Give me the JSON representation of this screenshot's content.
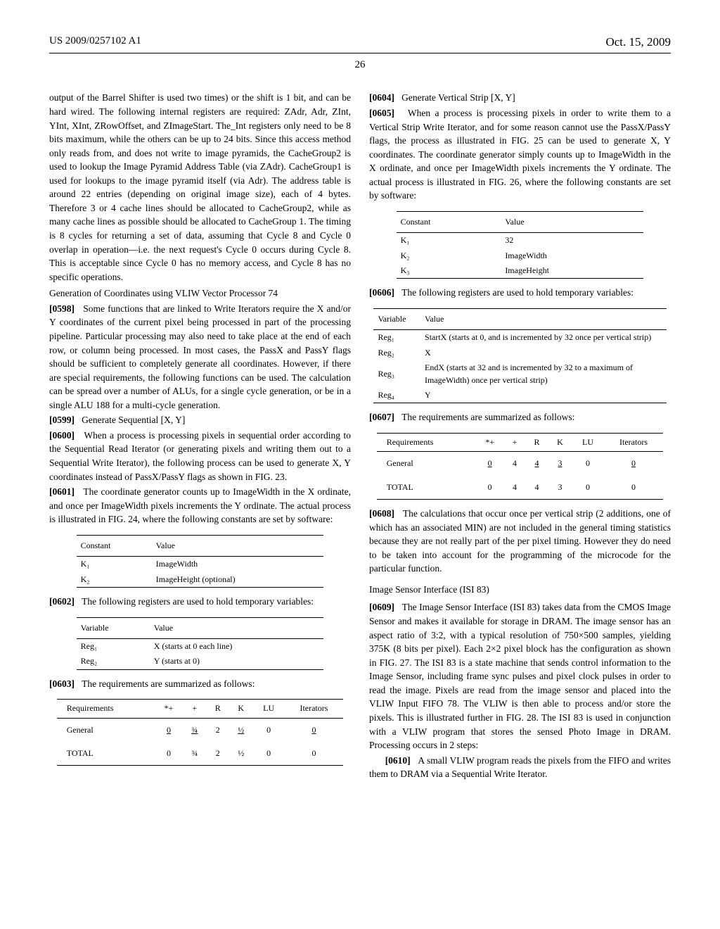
{
  "header": {
    "pub_number": "US 2009/0257102 A1",
    "date": "Oct. 15, 2009",
    "page": "26"
  },
  "left": {
    "p1": "output of the Barrel Shifter is used two times) or the shift is 1 bit, and can be hard wired. The following internal registers are required: ZAdr, Adr, ZInt, YInt, XInt, ZRowOffset, and ZImageStart. The_Int registers only need to be 8 bits maximum, while the others can be up to 24 bits. Since this access method only reads from, and does not write to image pyramids, the CacheGroup2 is used to lookup the Image Pyramid Address Table (via ZAdr). CacheGroup1 is used for lookups to the image pyramid itself (via Adr). The address table is around 22 entries (depending on original image size), each of 4 bytes. Therefore 3 or 4 cache lines should be allocated to CacheGroup2, while as many cache lines as possible should be allocated to CacheGroup 1. The timing is 8 cycles for returning a set of data, assuming that Cycle 8 and Cycle 0 overlap in operation—i.e. the next request's Cycle 0 occurs during Cycle 8. This is acceptable since Cycle 0 has no memory access, and Cycle 8 has no specific operations.",
    "gen_coords_head": "Generation of Coordinates using VLIW Vector Processor 74",
    "p0598_num": "[0598]",
    "p0598": "Some functions that are linked to Write Iterators require the X and/or Y coordinates of the current pixel being processed in part of the processing pipeline. Particular processing may also need to take place at the end of each row, or column being processed. In most cases, the PassX and PassY flags should be sufficient to completely generate all coordinates. However, if there are special requirements, the following functions can be used. The calculation can be spread over a number of ALUs, for a single cycle generation, or be in a single ALU 188 for a multi-cycle generation.",
    "p0599_num": "[0599]",
    "p0599": "Generate Sequential [X, Y]",
    "p0600_num": "[0600]",
    "p0600": "When a process is processing pixels in sequential order according to the Sequential Read Iterator (or generating pixels and writing them out to a Sequential Write Iterator), the following process can be used to generate X, Y coordinates instead of PassX/PassY flags as shown in FIG. 23.",
    "p0601_num": "[0601]",
    "p0601": "The coordinate generator counts up to ImageWidth in the X ordinate, and once per ImageWidth pixels increments the Y ordinate. The actual process is illustrated in FIG. 24, where the following constants are set by software:",
    "table1": {
      "h1": "Constant",
      "h2": "Value",
      "r1c1": "K₁",
      "r1c2": "ImageWidth",
      "r2c1": "K₂",
      "r2c2": "ImageHeight (optional)"
    },
    "p0602_num": "[0602]",
    "p0602": "The following registers are used to hold temporary variables:",
    "table2": {
      "h1": "Variable",
      "h2": "Value",
      "r1c1": "Reg₁",
      "r1c2": "X (starts at 0 each line)",
      "r2c1": "Reg₂",
      "r2c2": "Y (starts at 0)"
    },
    "p0603_num": "[0603]",
    "p0603": "The requirements are summarized as follows:",
    "table3": {
      "h": [
        "Requirements",
        "*+",
        "+",
        "R",
        "K",
        "LU",
        "Iterators"
      ],
      "general": [
        "General",
        "0",
        "¾",
        "2",
        "½",
        "0",
        "0"
      ],
      "total": [
        "TOTAL",
        "0",
        "¾",
        "2",
        "½",
        "0",
        "0"
      ]
    }
  },
  "right": {
    "p0604_num": "[0604]",
    "p0604": "Generate Vertical Strip [X, Y]",
    "p0605_num": "[0605]",
    "p0605": "When a process is processing pixels in order to write them to a Vertical Strip Write Iterator, and for some reason cannot use the PassX/PassY flags, the process as illustrated in FIG. 25 can be used to generate X, Y coordinates. The coordinate generator simply counts up to ImageWidth in the X ordinate, and once per ImageWidth pixels increments the Y ordinate. The actual process is illustrated in FIG. 26, where the following constants are set by software:",
    "table4": {
      "h1": "Constant",
      "h2": "Value",
      "r1c1": "K₁",
      "r1c2": "32",
      "r2c1": "K₂",
      "r2c2": "ImageWidth",
      "r3c1": "K₃",
      "r3c2": "ImageHeight"
    },
    "p0606_num": "[0606]",
    "p0606": "The following registers are used to hold temporary variables:",
    "table5": {
      "h1": "Variable",
      "h2": "Value",
      "r1c1": "Reg₁",
      "r1c2": "StartX (starts at 0, and is incremented by 32 once per vertical strip)",
      "r2c1": "Reg₂",
      "r2c2": "X",
      "r3c1": "Reg₃",
      "r3c2": "EndX (starts at 32 and is incremented by 32 to a maximum of ImageWidth) once per vertical strip)",
      "r4c1": "Reg₄",
      "r4c2": "Y"
    },
    "p0607_num": "[0607]",
    "p0607": "The requirements are summarized as follows:",
    "table6": {
      "h": [
        "Requirements",
        "*+",
        "+",
        "R",
        "K",
        "LU",
        "Iterators"
      ],
      "general": [
        "General",
        "0",
        "4",
        "4",
        "3",
        "0",
        "0"
      ],
      "total": [
        "TOTAL",
        "0",
        "4",
        "4",
        "3",
        "0",
        "0"
      ]
    },
    "p0608_num": "[0608]",
    "p0608": "The calculations that occur once per vertical strip (2 additions, one of which has an associated MIN) are not included in the general timing statistics because they are not really part of the per pixel timing. However they do need to be taken into account for the programming of the microcode for the particular function.",
    "isi_head": "Image Sensor Interface (ISI 83)",
    "p0609_num": "[0609]",
    "p0609": "The Image Sensor Interface (ISI 83) takes data from the CMOS Image Sensor and makes it available for storage in DRAM. The image sensor has an aspect ratio of 3:2, with a typical resolution of 750×500 samples, yielding 375K (8 bits per pixel). Each 2×2 pixel block has the configuration as shown in FIG. 27. The ISI 83 is a state machine that sends control information to the Image Sensor, including frame sync pulses and pixel clock pulses in order to read the image. Pixels are read from the image sensor and placed into the VLIW Input FIFO 78. The VLIW is then able to process and/or store the pixels. This is illustrated further in FIG. 28. The ISI 83 is used in conjunction with a VLIW program that stores the sensed Photo Image in DRAM. Processing occurs in 2 steps:",
    "p0610_num": "[0610]",
    "p0610": "A small VLIW program reads the pixels from the FIFO and writes them to DRAM via a Sequential Write Iterator."
  }
}
